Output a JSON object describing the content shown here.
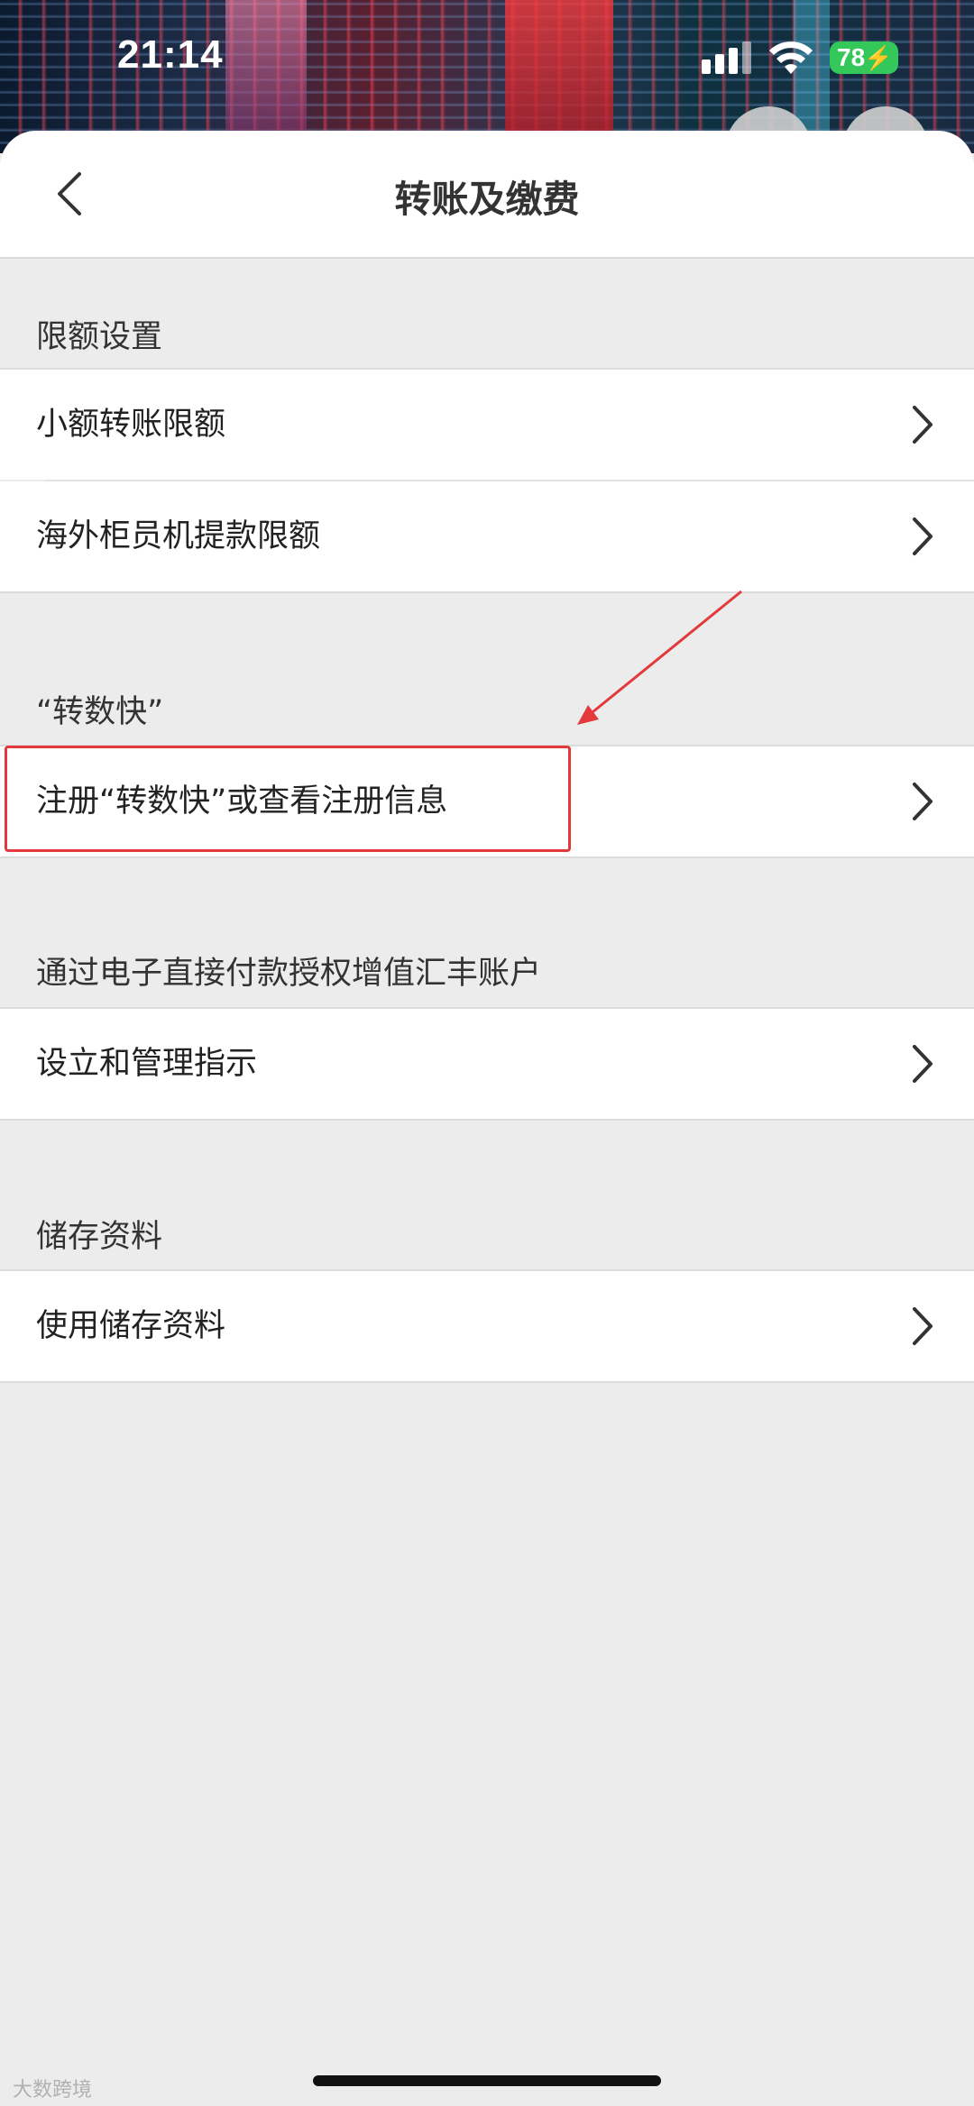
{
  "status_bar": {
    "time": "21:14",
    "battery": "78"
  },
  "nav": {
    "title": "转账及缴费"
  },
  "sections": [
    {
      "label": "限额设置",
      "items": [
        "小额转账限额",
        "海外柜员机提款限额"
      ]
    },
    {
      "label": "“转数快”",
      "items": [
        "注册“转数快”或查看注册信息"
      ]
    },
    {
      "label": "通过电子直接付款授权增值汇丰账户",
      "items": [
        "设立和管理指示"
      ]
    },
    {
      "label": "储存资料",
      "items": [
        "使用储存资料"
      ]
    }
  ],
  "watermark": "大数跨境",
  "colors": {
    "highlight": "#e4393c",
    "battery": "#34c759"
  }
}
